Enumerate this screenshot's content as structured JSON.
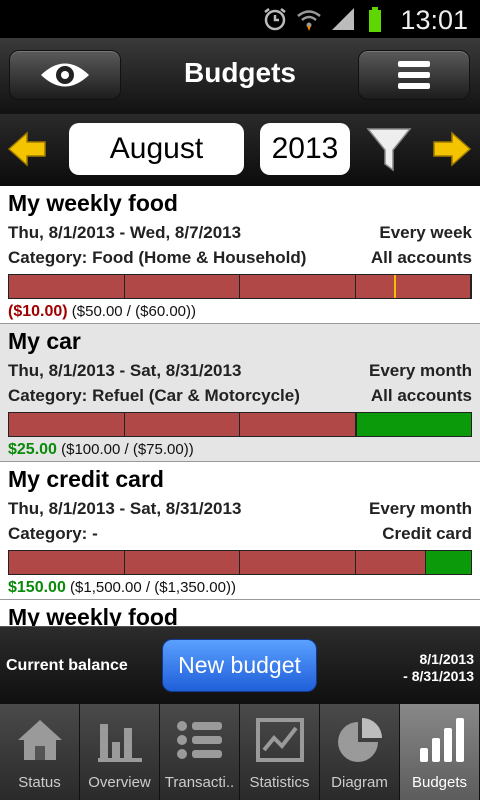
{
  "status_bar": {
    "time": "13:01",
    "icons": [
      "alarm-icon",
      "wifi-icon",
      "signal-icon",
      "battery-icon"
    ]
  },
  "header": {
    "title": "Budgets",
    "left_icon": "eye-icon",
    "right_icon": "menu-icon"
  },
  "period": {
    "month": "August",
    "year": "2013",
    "prev_icon": "arrow-left-icon",
    "next_icon": "arrow-right-icon",
    "filter_icon": "filter-icon"
  },
  "budgets": [
    {
      "name": "My weekly food",
      "dates": "Thu, 8/1/2013 - Wed, 8/7/2013",
      "recurrence": "Every week",
      "category": "Category: Food (Home & Household)",
      "accounts": "All accounts",
      "balance": "($10.00)",
      "detail": "($50.00 / ($60.00))",
      "balance_color": "#a00000",
      "progress": 1.0,
      "marker": 0.833
    },
    {
      "name": "My car",
      "dates": "Thu, 8/1/2013 - Sat, 8/31/2013",
      "recurrence": "Every month",
      "category": "Category: Refuel (Car & Motorcycle)",
      "accounts": "All accounts",
      "balance": "$25.00",
      "detail": "($100.00 / ($75.00))",
      "balance_color": "#0a8a0a",
      "progress": 0.75
    },
    {
      "name": "My credit card",
      "dates": "Thu, 8/1/2013 - Sat, 8/31/2013",
      "recurrence": "Every month",
      "category": "Category: -",
      "accounts": "Credit card",
      "balance": "$150.00",
      "detail": "($1,500.00 / ($1,350.00))",
      "balance_color": "#0a8a0a",
      "progress": 0.9
    },
    {
      "name": "My weekly food"
    }
  ],
  "footer": {
    "label": "Current balance",
    "new_button": "New budget",
    "range_line1": "8/1/2013",
    "range_line2": "- 8/31/2013"
  },
  "tabs": [
    {
      "label": "Status",
      "icon": "home-icon",
      "active": false
    },
    {
      "label": "Overview",
      "icon": "bar-chart-icon",
      "active": false
    },
    {
      "label": "Transacti..",
      "icon": "list-icon",
      "active": false
    },
    {
      "label": "Statistics",
      "icon": "line-chart-icon",
      "active": false
    },
    {
      "label": "Diagram",
      "icon": "pie-chart-icon",
      "active": false
    },
    {
      "label": "Budgets",
      "icon": "budget-bars-icon",
      "active": true
    }
  ],
  "colors": {
    "bar_red": "#b04848",
    "bar_green": "#0a9a0a",
    "marker": "#f0c000",
    "new_button": "#2f74e8"
  }
}
